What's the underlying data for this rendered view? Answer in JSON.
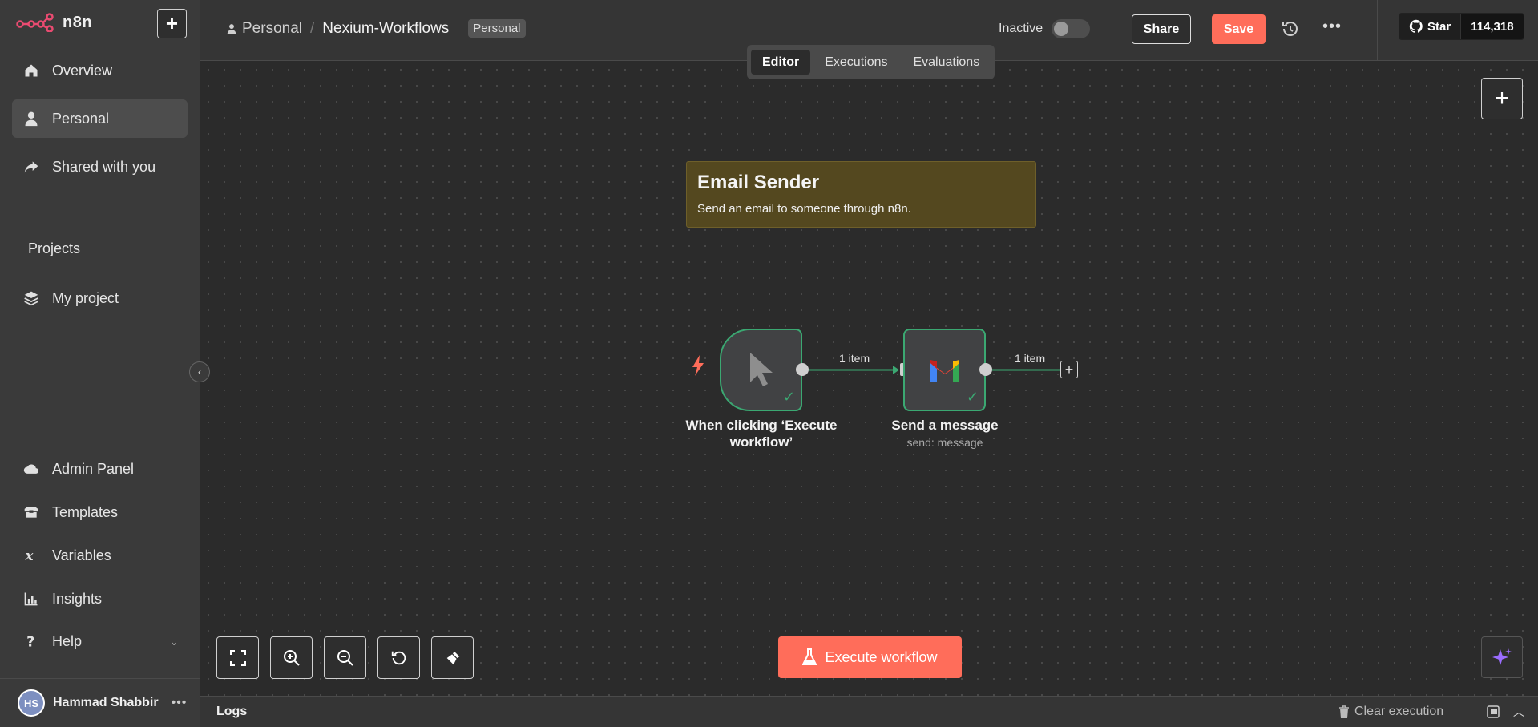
{
  "app": {
    "logo_text": "n8n"
  },
  "sidebar": {
    "items_top": [
      {
        "label": "Overview",
        "icon": "home-icon"
      },
      {
        "label": "Personal",
        "icon": "user-icon",
        "active": true
      },
      {
        "label": "Shared with you",
        "icon": "share-icon"
      }
    ],
    "projects_title": "Projects",
    "projects": [
      {
        "label": "My project",
        "icon": "layers-icon"
      }
    ],
    "items_bottom": [
      {
        "label": "Admin Panel",
        "icon": "cloud-icon"
      },
      {
        "label": "Templates",
        "icon": "box-icon"
      },
      {
        "label": "Variables",
        "icon": "variable-icon"
      },
      {
        "label": "Insights",
        "icon": "chart-icon"
      },
      {
        "label": "Help",
        "icon": "question-icon"
      }
    ],
    "user": {
      "initials": "HS",
      "name": "Hammad Shabbir",
      "menu": "•••"
    }
  },
  "header": {
    "breadcrumb_personal": "Personal",
    "separator": "/",
    "workflow_name": "Nexium-Workflows",
    "tag": "Personal",
    "active_label": "Inactive",
    "share_label": "Share",
    "save_label": "Save",
    "more": "•••",
    "github": {
      "star_label": "Star",
      "count": "114,318"
    }
  },
  "tabs": [
    {
      "label": "Editor",
      "active": true
    },
    {
      "label": "Executions"
    },
    {
      "label": "Evaluations"
    }
  ],
  "canvas": {
    "sticky": {
      "title": "Email Sender",
      "description": "Send an email to someone through n8n."
    },
    "nodes": [
      {
        "label_line1": "When clicking ‘Execute",
        "label_line2": "workflow’"
      },
      {
        "label": "Send a message",
        "subtitle": "send: message"
      }
    ],
    "edges": [
      {
        "label": "1 item"
      },
      {
        "label": "1 item"
      }
    ],
    "execute_label": "Execute workflow",
    "colors": {
      "accent": "#ff6d5a",
      "success": "#3ba872",
      "sticky": "#54481f"
    }
  },
  "logs": {
    "title": "Logs",
    "clear_label": "Clear execution"
  }
}
